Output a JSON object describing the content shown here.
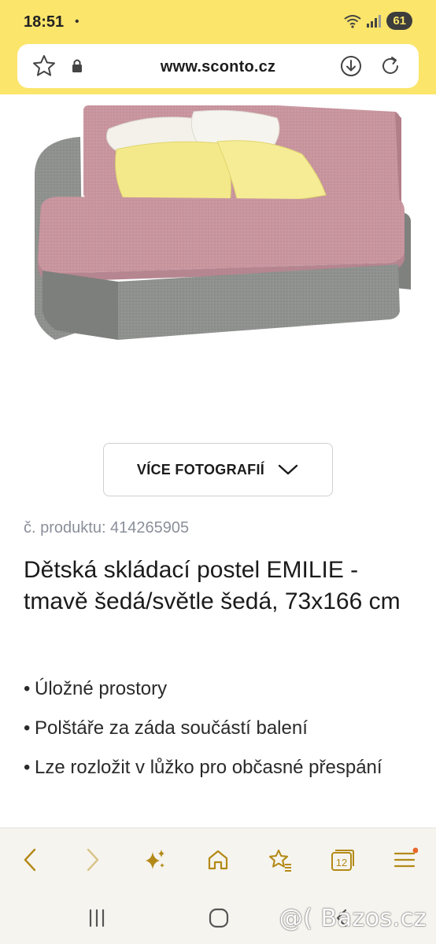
{
  "status_bar": {
    "time": "18:51",
    "dot": "•",
    "battery": "61"
  },
  "browser": {
    "url": "www.sconto.cz",
    "tab_count": "12"
  },
  "product": {
    "more_photos_label": "VÍCE FOTOGRAFIÍ",
    "product_number": "č. produktu: 414265905",
    "title": "Dětská skládací postel EMILIE - tmavě šedá/světle šedá, 73x166 cm",
    "features": [
      "Úložné prostory",
      "Polštáře za záda součástí balení",
      "Lze rozložit v lůžko pro občasné přespání"
    ]
  },
  "watermark": "@( Bazos.cz",
  "colors": {
    "header_yellow": "#fbe56b",
    "accent_gold": "#b38a17",
    "sofa_pink": "#c8959e",
    "sofa_gray": "#8d8f8c",
    "pillow_yellow": "#f5ea8a"
  },
  "icons": {
    "bookmark": "star-icon",
    "security": "lock-icon",
    "download": "download-icon",
    "reload": "reload-icon",
    "more_photos": "chevron-down-icon",
    "back": "back-arrow-icon",
    "forward": "forward-arrow-icon",
    "ai": "sparkle-icon",
    "home": "home-icon",
    "favorites": "bookmarks-star-icon",
    "tabs": "tabs-icon",
    "menu": "hamburger-menu-icon"
  }
}
